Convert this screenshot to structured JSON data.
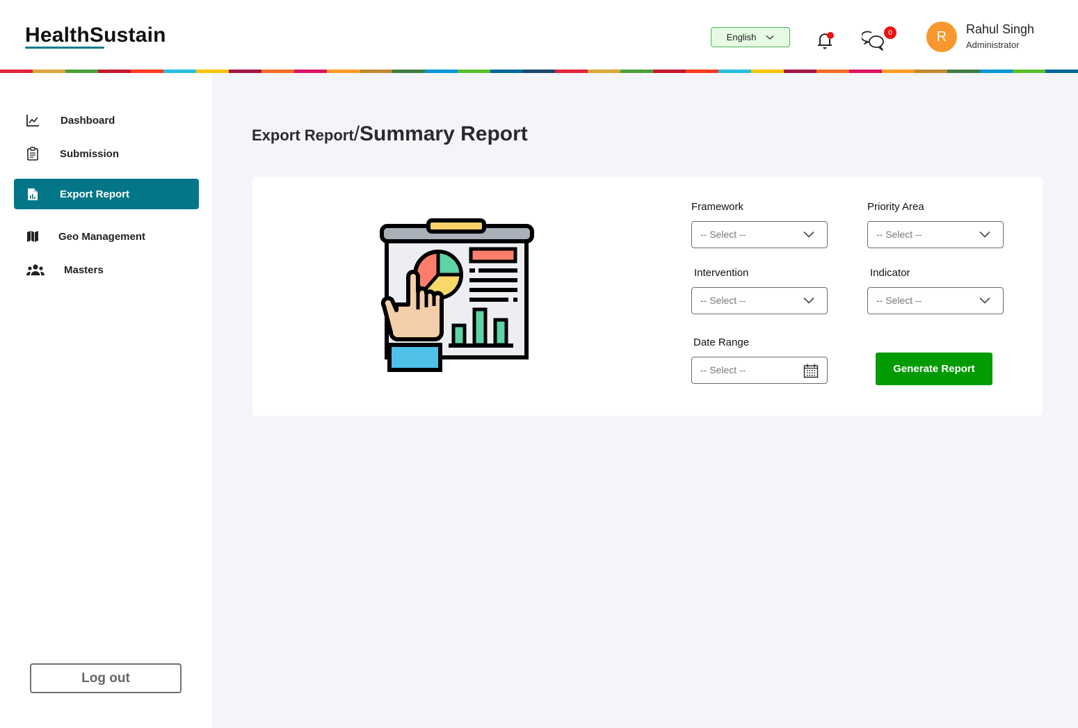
{
  "app": {
    "logo": "HealthSustain"
  },
  "header": {
    "language": {
      "selected": "English"
    },
    "notifications": {
      "has_unread": true
    },
    "messages": {
      "badge_count": "0"
    },
    "user": {
      "initial": "R",
      "name": "Rahul Singh",
      "role": "Administrator"
    },
    "rainbow_colors": [
      "#e5243b",
      "#dda63a",
      "#4c9f38",
      "#c5192d",
      "#ff3a21",
      "#26bde2",
      "#fcc30b",
      "#a21942",
      "#fd6925",
      "#dd1367",
      "#fd9d24",
      "#bf8b2e",
      "#3f7e44",
      "#0a97d9",
      "#56c02b",
      "#00689d",
      "#19486a",
      "#e5243b",
      "#dda63a",
      "#4c9f38",
      "#c5192d",
      "#ff3a21",
      "#26bde2",
      "#fcc30b",
      "#a21942",
      "#fd6925",
      "#dd1367",
      "#fd9d24",
      "#bf8b2e",
      "#3f7e44",
      "#0a97d9",
      "#56c02b",
      "#00689d"
    ],
    "accent_color": "#037787"
  },
  "sidebar": {
    "items": [
      {
        "label": "Dashboard",
        "icon": "line-chart-icon",
        "active": false
      },
      {
        "label": "Submission",
        "icon": "clipboard-icon",
        "active": false
      },
      {
        "label": "Export Report",
        "icon": "report-file-icon",
        "active": true
      },
      {
        "label": "Geo Management",
        "icon": "map-icon",
        "active": false
      },
      {
        "label": "Masters",
        "icon": "users-icon",
        "active": false
      }
    ],
    "logout_label": "Log out"
  },
  "main": {
    "breadcrumb_parent": "Export Report",
    "breadcrumb_separator": "/",
    "title": "Summary Report",
    "form": {
      "framework": {
        "label": "Framework",
        "placeholder": "-- Select --"
      },
      "priority_area": {
        "label": "Priority Area",
        "placeholder": "-- Select --"
      },
      "intervention": {
        "label": "Intervention",
        "placeholder": "-- Select --"
      },
      "indicator": {
        "label": "Indicator",
        "placeholder": "-- Select --"
      },
      "date_range": {
        "label": "Date Range",
        "placeholder": "-- Select --"
      },
      "generate_label": "Generate Report",
      "generate_color": "#039b03"
    }
  }
}
